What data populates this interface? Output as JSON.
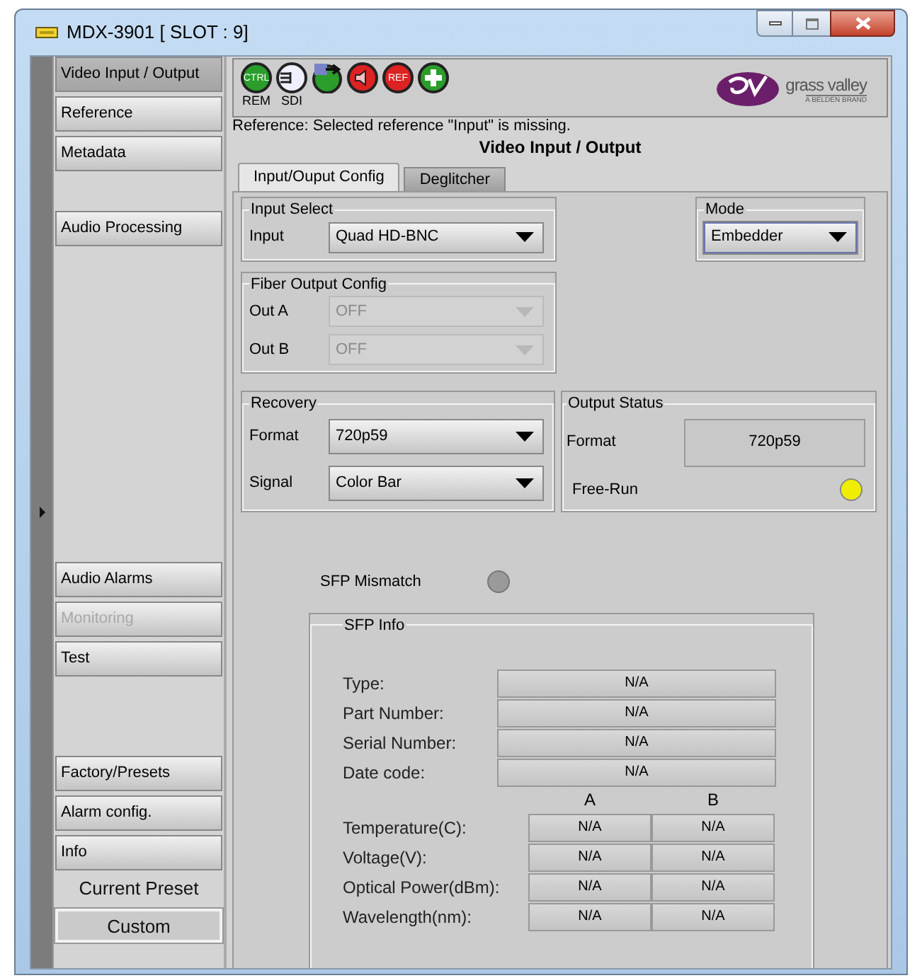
{
  "window": {
    "title": "MDX-3901 [ SLOT : 9]"
  },
  "sidebar": {
    "groups": [
      [
        {
          "label": "Video Input / Output",
          "selected": true,
          "disabled": false
        },
        {
          "label": "Reference",
          "selected": false,
          "disabled": false
        },
        {
          "label": "Metadata",
          "selected": false,
          "disabled": false
        }
      ],
      [
        {
          "label": "Audio Processing",
          "selected": false,
          "disabled": false
        }
      ],
      [
        {
          "label": "Audio Alarms",
          "selected": false,
          "disabled": false
        },
        {
          "label": "Monitoring",
          "selected": false,
          "disabled": true
        },
        {
          "label": "Test",
          "selected": false,
          "disabled": false
        }
      ],
      [
        {
          "label": "Factory/Presets",
          "selected": false,
          "disabled": false
        },
        {
          "label": "Alarm config.",
          "selected": false,
          "disabled": false
        },
        {
          "label": "Info",
          "selected": false,
          "disabled": false
        }
      ]
    ],
    "current_preset": {
      "label": "Current Preset",
      "value": "Custom"
    }
  },
  "status_icons": [
    {
      "kind": "badge",
      "text": "CTRL",
      "caption": "REM",
      "color": "#2a9d2a"
    },
    {
      "kind": "connector",
      "caption": "SDI"
    },
    {
      "kind": "arrow",
      "color": "#2a9d2a"
    },
    {
      "kind": "speaker",
      "color": "#dd2222"
    },
    {
      "kind": "badge",
      "text": "REF",
      "color": "#dd2222"
    },
    {
      "kind": "plus",
      "color": "#2a9d2a"
    }
  ],
  "logo": {
    "name": "grass valley",
    "tagline": "A BELDEN BRAND"
  },
  "message": "Reference: Selected reference \"Input\" is missing.",
  "page_title": "Video Input / Output",
  "tabs": [
    {
      "label": "Input/Ouput Config",
      "selected": true
    },
    {
      "label": "Deglitcher",
      "selected": false
    }
  ],
  "input_select": {
    "title": "Input Select",
    "label": "Input",
    "value": "Quad HD-BNC"
  },
  "mode": {
    "title": "Mode",
    "value": "Embedder"
  },
  "fiber_output_config": {
    "title": "Fiber Output Config",
    "rows": [
      {
        "label": "Out A",
        "value": "OFF",
        "disabled": true
      },
      {
        "label": "Out B",
        "value": "OFF",
        "disabled": true
      }
    ]
  },
  "recovery": {
    "title": "Recovery",
    "rows": [
      {
        "label": "Format",
        "value": "720p59"
      },
      {
        "label": "Signal",
        "value": "Color Bar"
      }
    ]
  },
  "output_status": {
    "title": "Output Status",
    "format_label": "Format",
    "format_value": "720p59",
    "led": {
      "label": "Free-Run",
      "color": "#f0ee00"
    }
  },
  "sfp_mismatch": {
    "label": "SFP Mismatch",
    "color": "#9a9a9a"
  },
  "sfp_info": {
    "title": "SFP Info",
    "rows": [
      {
        "label": "Type:",
        "value": "N/A"
      },
      {
        "label": "Part Number:",
        "value": "N/A"
      },
      {
        "label": "Serial Number:",
        "value": "N/A"
      },
      {
        "label": "Date code:",
        "value": "N/A"
      }
    ],
    "columns": [
      "A",
      "B"
    ],
    "pair_rows": [
      {
        "label": "Temperature(C):",
        "a": "N/A",
        "b": "N/A"
      },
      {
        "label": "Voltage(V):",
        "a": "N/A",
        "b": "N/A"
      },
      {
        "label": "Optical Power(dBm):",
        "a": "N/A",
        "b": "N/A"
      },
      {
        "label": "Wavelength(nm):",
        "a": "N/A",
        "b": "N/A"
      }
    ]
  }
}
